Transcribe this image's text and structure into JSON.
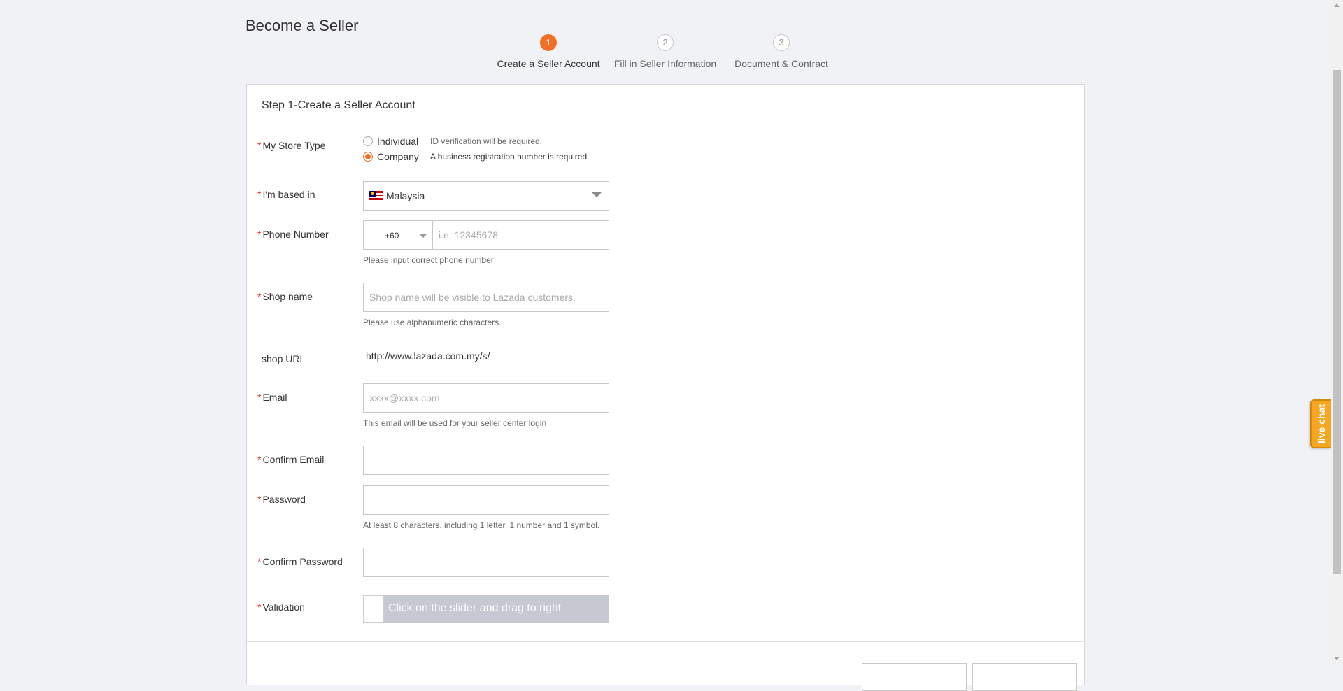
{
  "page": {
    "title": "Become a Seller"
  },
  "stepper": {
    "steps": [
      {
        "number": "1",
        "label": "Create a Seller Account",
        "active": true
      },
      {
        "number": "2",
        "label": "Fill in Seller Information",
        "active": false
      },
      {
        "number": "3",
        "label": "Document & Contract",
        "active": false
      }
    ]
  },
  "form": {
    "title": "Step 1-Create a Seller Account",
    "required_mark": "*",
    "store_type": {
      "label": "My Store Type",
      "options": [
        {
          "label": "Individual",
          "hint": "ID verification will be required.",
          "checked": false
        },
        {
          "label": "Company",
          "hint": "A business registration number is required.",
          "checked": true
        }
      ]
    },
    "based_in": {
      "label": "I'm based in",
      "value": "Malaysia",
      "flag_icon": "malaysia-flag-icon"
    },
    "phone": {
      "label": "Phone Number",
      "code": "+60",
      "placeholder": "i.e. 12345678",
      "hint": "Please input correct phone number"
    },
    "shop_name": {
      "label": "Shop name",
      "placeholder": "Shop name will be visible to Lazada customers.",
      "hint": "Please use alphanumeric characters."
    },
    "shop_url": {
      "label": "shop URL",
      "value": "http://www.lazada.com.my/s/"
    },
    "email": {
      "label": "Email",
      "placeholder": "xxxx@xxxx.com",
      "hint": "This email will be used for your seller center login"
    },
    "confirm_email": {
      "label": "Confirm Email",
      "placeholder": ""
    },
    "password": {
      "label": "Password",
      "placeholder": "",
      "hint": "At least 8 characters, including 1 letter, 1 number and 1 symbol."
    },
    "confirm_password": {
      "label": "Confirm Password",
      "placeholder": ""
    },
    "validation": {
      "label": "Validation",
      "slider_text": "Click on the slider and drag to right"
    }
  },
  "live_chat": {
    "label": "live chat"
  },
  "colors": {
    "accent": "#f36f26",
    "required": "#e4393c",
    "slider_track": "#c6c9d2",
    "live_chat": "#f5a623",
    "page_bg": "#f1f2f5"
  }
}
